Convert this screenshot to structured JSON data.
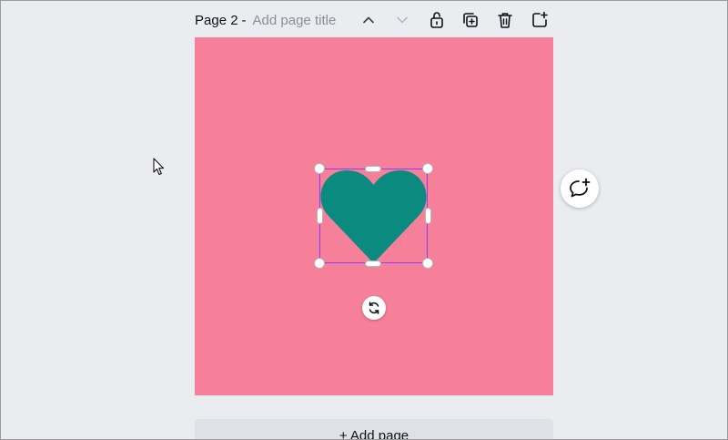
{
  "header": {
    "page_label": "Page 2",
    "separator": "-",
    "title_placeholder": "Add page title"
  },
  "toolbar": {
    "icons": [
      "chevron-up-icon",
      "chevron-down-icon",
      "lock-icon",
      "duplicate-page-icon",
      "delete-icon",
      "add-page-icon"
    ]
  },
  "canvas": {
    "background_color": "#f6809a",
    "heart_color": "#0b8a7f",
    "selection_color": "#8b3dff"
  },
  "comment": {
    "icon": "add-comment-icon"
  },
  "footer": {
    "add_page_label": "+ Add page"
  }
}
